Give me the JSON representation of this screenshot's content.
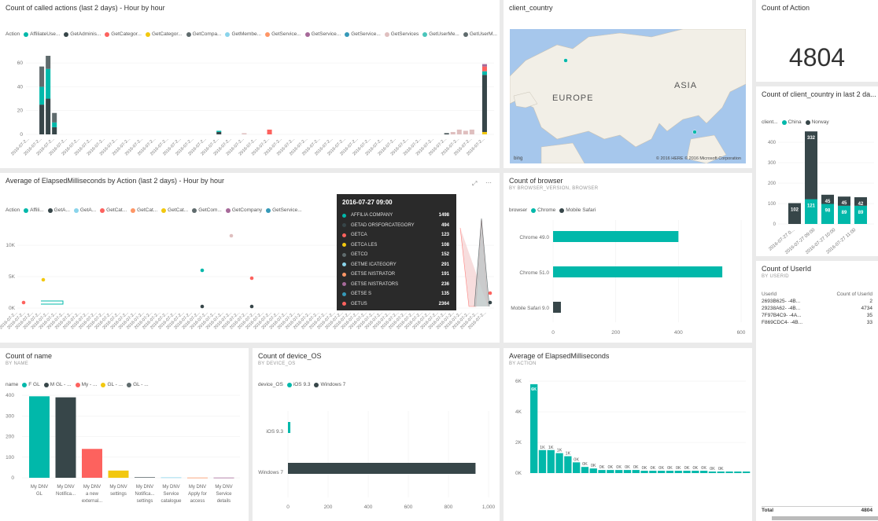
{
  "colors": {
    "teal": "#01b8aa",
    "dark": "#374649",
    "red": "#fd625e",
    "yellow": "#f2c80f",
    "gray": "#5f6b6d",
    "lightblue": "#8ad4eb",
    "orange": "#fe9666",
    "purple": "#a66999",
    "blue": "#3599b8",
    "pink": "#dfbfbf",
    "cyan": "#4ac5bb",
    "slate": "#5f6b6d",
    "salmon": "#fb8281"
  },
  "tiles": {
    "called_actions": {
      "title": "Count of called actions (last 2 days) - Hour by hour",
      "legend_title": "Action",
      "legend": [
        {
          "name": "AffiliateUse...",
          "color": "#01b8aa"
        },
        {
          "name": "GetAdminis...",
          "color": "#374649"
        },
        {
          "name": "GetCategor...",
          "color": "#fd625e"
        },
        {
          "name": "GetCategor...",
          "color": "#f2c80f"
        },
        {
          "name": "GetCompa...",
          "color": "#5f6b6d"
        },
        {
          "name": "GetMembe...",
          "color": "#8ad4eb"
        },
        {
          "name": "GetService...",
          "color": "#fe9666"
        },
        {
          "name": "GetService...",
          "color": "#a66999"
        },
        {
          "name": "GetService...",
          "color": "#3599b8"
        },
        {
          "name": "GetServices",
          "color": "#dfbfbf"
        },
        {
          "name": "GetUserMe...",
          "color": "#4ac5bb"
        },
        {
          "name": "GetUserM...",
          "color": "#5f6b6d"
        }
      ],
      "y_ticks": [
        "0",
        "20",
        "40",
        "60"
      ],
      "x_tick_label": "2016-07-2..."
    },
    "elapsed_by_action": {
      "title": "Average of ElapsedMilliseconds by Action (last 2 days) - Hour by hour",
      "legend_title": "Action",
      "legend": [
        {
          "name": "Affili...",
          "color": "#01b8aa"
        },
        {
          "name": "GetA...",
          "color": "#374649"
        },
        {
          "name": "GetA...",
          "color": "#8ad4eb"
        },
        {
          "name": "GetCat...",
          "color": "#fd625e"
        },
        {
          "name": "GetCat...",
          "color": "#fe9666"
        },
        {
          "name": "GetCat...",
          "color": "#f2c80f"
        },
        {
          "name": "GetCom...",
          "color": "#5f6b6d"
        },
        {
          "name": "GetCompany",
          "color": "#a66999"
        },
        {
          "name": "GetService...",
          "color": "#3599b8"
        }
      ],
      "y_ticks": [
        "0K",
        "5K",
        "10K"
      ],
      "tooltip": {
        "title": "2016-07-27 09:00",
        "rows": [
          {
            "label": "AFFILIA              COMPANY",
            "value": "1498",
            "color": "#01b8aa"
          },
          {
            "label": "GETAD               ORSFORCATEGORY",
            "value": "494",
            "color": "#374649"
          },
          {
            "label": "GETCA",
            "value": "123",
            "color": "#fd625e"
          },
          {
            "label": "GETCA               LES",
            "value": "108",
            "color": "#f2c80f"
          },
          {
            "label": "GETCO",
            "value": "152",
            "color": "#5f6b6d"
          },
          {
            "label": "GETME               ICATEGORY",
            "value": "291",
            "color": "#8ad4eb"
          },
          {
            "label": "GETSE               NISTRATOR",
            "value": "191",
            "color": "#fe9666"
          },
          {
            "label": "GETSE               NISTRATORS",
            "value": "236",
            "color": "#a66999"
          },
          {
            "label": "GETSE               S",
            "value": "135",
            "color": "#3599b8"
          },
          {
            "label": "GETUS",
            "value": "2364",
            "color": "#fd625e"
          }
        ]
      }
    },
    "client_country_map": {
      "title": "client_country",
      "labels": [
        "EUROPE",
        "ASIA"
      ],
      "attribution": "© 2016 HERE  © 2016 Microsoft Corporation",
      "bing": "bing"
    },
    "count_action": {
      "title": "Count of Action",
      "value": "4804"
    },
    "country_chart": {
      "title": "Count of client_country in last 2 da...",
      "legend_title": "client...",
      "legend": [
        {
          "name": "China",
          "color": "#01b8aa"
        },
        {
          "name": "Norway",
          "color": "#374649"
        }
      ],
      "y_ticks": [
        "0",
        "100",
        "200",
        "300",
        "400"
      ],
      "x_labels": [
        "2016-07-27 0...",
        "2016-07-27 09:00",
        "2016-07-27 10:00",
        "2016-07-27 11:00"
      ]
    },
    "browser": {
      "title": "Count of browser",
      "subtitle": "BY BROWSER_VERSION, BROWSER",
      "legend_title": "browser",
      "legend": [
        {
          "name": "Chrome",
          "color": "#01b8aa"
        },
        {
          "name": "Mobile Safari",
          "color": "#374649"
        }
      ],
      "x_ticks": [
        "0",
        "200",
        "400",
        "600"
      ]
    },
    "userid": {
      "title": "Count of UserId",
      "subtitle": "BY USERID",
      "col1": "UserId",
      "col2": "Count of UserId",
      "rows": [
        {
          "id": "2693B625-          -4B...",
          "count": "2"
        },
        {
          "id": "29238A62-          -4B...",
          "count": "4734"
        },
        {
          "id": "7F97B4C9-          -4A...",
          "count": "35"
        },
        {
          "id": "F869CDC4-          -4B...",
          "count": "33"
        }
      ],
      "total_label": "Total",
      "total_value": "4804"
    },
    "name": {
      "title": "Count of name",
      "subtitle": "BY NAME",
      "legend_title": "name",
      "legend": [
        {
          "name": "F        GL",
          "color": "#01b8aa"
        },
        {
          "name": "M         GL - ...",
          "color": "#374649"
        },
        {
          "name": "My          - ...",
          "color": "#fd625e"
        },
        {
          "name": "           GL - ...",
          "color": "#f2c80f"
        },
        {
          "name": "           GL - ...",
          "color": "#5f6b6d"
        }
      ],
      "y_ticks": [
        "0",
        "100",
        "200",
        "300",
        "400"
      ],
      "x_labels": [
        [
          "My DNV",
          "GL"
        ],
        [
          "My DNV",
          "Notifica..."
        ],
        [
          "My DNV",
          "a new",
          "external..."
        ],
        [
          "My DNV",
          "settings"
        ],
        [
          "My DNV",
          "Notifica...",
          "settings"
        ],
        [
          "My DNV",
          "Service",
          "catalogue"
        ],
        [
          "My DNV",
          "Apply for",
          "access"
        ],
        [
          "My DNV",
          "Service",
          "details"
        ]
      ]
    },
    "device_os": {
      "title": "Count of device_OS",
      "subtitle": "BY DEVICE_OS",
      "legend_title": "device_OS",
      "legend": [
        {
          "name": "iOS 9.3",
          "color": "#01b8aa"
        },
        {
          "name": "Windows 7",
          "color": "#374649"
        }
      ],
      "x_ticks": [
        "0",
        "200",
        "400",
        "600",
        "800",
        "1,000"
      ]
    },
    "avg_elapsed": {
      "title": "Average of ElapsedMilliseconds",
      "subtitle": "BY ACTION",
      "y_ticks": [
        "0K",
        "2K",
        "4K",
        "6K"
      ]
    }
  },
  "chart_data": [
    {
      "type": "bar",
      "title": "Count of called actions (last 2 days) - Hour by hour",
      "stacked": true,
      "ylim": [
        0,
        70
      ],
      "bars": [
        {
          "i": 2,
          "segments": [
            {
              "color": "#374649",
              "v": 25
            },
            {
              "color": "#01b8aa",
              "v": 15
            },
            {
              "color": "#5f6b6d",
              "v": 17
            }
          ]
        },
        {
          "i": 3,
          "segments": [
            {
              "color": "#374649",
              "v": 30
            },
            {
              "color": "#01b8aa",
              "v": 25
            },
            {
              "color": "#5f6b6d",
              "v": 11
            }
          ]
        },
        {
          "i": 4,
          "segments": [
            {
              "color": "#374649",
              "v": 6
            },
            {
              "color": "#01b8aa",
              "v": 4
            },
            {
              "color": "#5f6b6d",
              "v": 8
            }
          ]
        },
        {
          "i": 30,
          "segments": [
            {
              "color": "#374649",
              "v": 2
            },
            {
              "color": "#01b8aa",
              "v": 1
            }
          ]
        },
        {
          "i": 34,
          "segments": [
            {
              "color": "#dfbfbf",
              "v": 1
            }
          ]
        },
        {
          "i": 38,
          "segments": [
            {
              "color": "#fd625e",
              "v": 4
            }
          ]
        },
        {
          "i": 66,
          "segments": [
            {
              "color": "#374649",
              "v": 1
            }
          ]
        },
        {
          "i": 67,
          "segments": [
            {
              "color": "#dfbfbf",
              "v": 2
            }
          ]
        },
        {
          "i": 68,
          "segments": [
            {
              "color": "#dfbfbf",
              "v": 4
            }
          ]
        },
        {
          "i": 69,
          "segments": [
            {
              "color": "#dfbfbf",
              "v": 3
            }
          ]
        },
        {
          "i": 70,
          "segments": [
            {
              "color": "#dfbfbf",
              "v": 4
            }
          ]
        },
        {
          "i": 72,
          "segments": [
            {
              "color": "#f2c80f",
              "v": 2
            },
            {
              "color": "#374649",
              "v": 48
            },
            {
              "color": "#01b8aa",
              "v": 3
            },
            {
              "color": "#fd625e",
              "v": 4
            },
            {
              "color": "#a66999",
              "v": 2
            }
          ]
        }
      ],
      "n": 74
    },
    {
      "type": "bar",
      "title": "Count of client_country in last 2 da...",
      "stacked": true,
      "ylim": [
        0,
        450
      ],
      "categories": [
        "2016-07-27 0...",
        "2016-07-27 09:00",
        "2016-07-27 10:00",
        "2016-07-27 11:00"
      ],
      "bars": [
        {
          "segments": [
            {
              "color": "#374649",
              "v": 102,
              "label": "102"
            }
          ]
        },
        {
          "segments": [
            {
              "color": "#01b8aa",
              "v": 121,
              "label": "121"
            },
            {
              "color": "#374649",
              "v": 332,
              "label": "332"
            }
          ]
        },
        {
          "segments": [
            {
              "color": "#01b8aa",
              "v": 98,
              "label": "98"
            },
            {
              "color": "#374649",
              "v": 45,
              "label": "45"
            }
          ]
        },
        {
          "segments": [
            {
              "color": "#01b8aa",
              "v": 89,
              "label": "89"
            },
            {
              "color": "#374649",
              "v": 45,
              "label": "45"
            }
          ]
        },
        {
          "segments": [
            {
              "color": "#01b8aa",
              "v": 89,
              "label": "89"
            },
            {
              "color": "#374649",
              "v": 42,
              "label": "42"
            }
          ]
        }
      ]
    },
    {
      "type": "bar",
      "title": "Count of browser",
      "orientation": "horizontal",
      "categories": [
        "Chrome 49.0",
        "Chrome 51.0",
        "Mobile Safari 9.0"
      ],
      "values": [
        400,
        540,
        25
      ],
      "colors": [
        "#01b8aa",
        "#01b8aa",
        "#374649"
      ],
      "xlim": [
        0,
        600
      ]
    },
    {
      "type": "bar",
      "title": "Count of name",
      "values": [
        395,
        390,
        140,
        35,
        3,
        2,
        1,
        1
      ],
      "colors": [
        "#01b8aa",
        "#374649",
        "#fd625e",
        "#f2c80f",
        "#5f6b6d",
        "#8ad4eb",
        "#fe9666",
        "#a66999"
      ],
      "ylim": [
        0,
        420
      ]
    },
    {
      "type": "bar",
      "title": "Count of device_OS",
      "orientation": "horizontal",
      "categories": [
        "iOS 9.3",
        "Windows 7"
      ],
      "values": [
        12,
        935
      ],
      "colors": [
        "#01b8aa",
        "#374649"
      ],
      "xlim": [
        0,
        1000
      ]
    },
    {
      "type": "bar",
      "title": "Average of ElapsedMilliseconds",
      "values": [
        5800,
        1500,
        1500,
        1300,
        1100,
        700,
        400,
        300,
        200,
        200,
        200,
        200,
        200,
        150,
        150,
        150,
        150,
        150,
        150,
        150,
        150,
        100,
        100,
        100,
        100,
        100
      ],
      "labels": [
        "6K",
        "1K",
        "1K",
        "1K",
        "1K",
        "0K",
        "0K",
        "0K",
        "0K",
        "0K",
        "0K",
        "0K",
        "0K",
        "0K",
        "0K",
        "0K",
        "0K",
        "0K",
        "0K",
        "0K",
        "0K",
        "0K",
        "0K",
        "",
        "",
        ""
      ],
      "ylim": [
        0,
        6000
      ]
    }
  ]
}
